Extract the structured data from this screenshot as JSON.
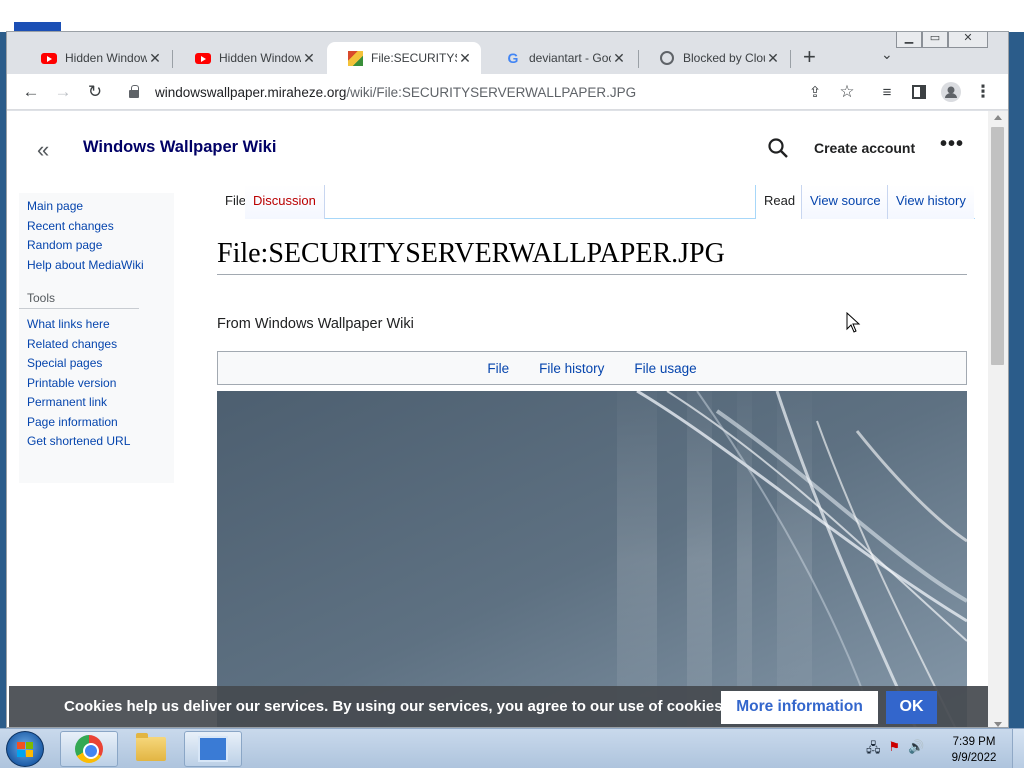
{
  "browser": {
    "tabs": [
      {
        "title": "Hidden Windows",
        "icon": "youtube-icon"
      },
      {
        "title": "Hidden Windows",
        "icon": "youtube-icon"
      },
      {
        "title": "File:SECURITYSERVERWALLPAPER",
        "icon": "wiki-favicon"
      },
      {
        "title": "deviantart - Google",
        "icon": "google-icon"
      },
      {
        "title": "Blocked by Cloudflare",
        "icon": "globe-icon"
      }
    ],
    "url_host": "windowswallpaper.miraheze.org",
    "url_path": "/wiki/File:SECURITYSERVERWALLPAPER.JPG"
  },
  "wiki": {
    "site_title": "Windows Wallpaper Wiki",
    "create_account": "Create account",
    "sidebar": {
      "nav": [
        "Main page",
        "Recent changes",
        "Random page",
        "Help about MediaWiki"
      ],
      "tools_heading": "Tools",
      "tools": [
        "What links here",
        "Related changes",
        "Special pages",
        "Printable version",
        "Permanent link",
        "Page information",
        "Get shortened URL"
      ]
    },
    "tabs": {
      "file": "File",
      "discussion": "Discussion",
      "read": "Read",
      "view_source": "View source",
      "view_history": "View history"
    },
    "page_title": "File:SECURITYSERVERWALLPAPER.JPG",
    "site_sub": "From Windows Wallpaper Wiki",
    "file_toc": [
      "File",
      "File history",
      "File usage"
    ]
  },
  "cookie": {
    "message": "Cookies help us deliver our services. By using our services, you agree to our use of cookies.",
    "more_info": "More information",
    "ok": "OK"
  },
  "taskbar": {
    "apps": [
      "chrome-icon",
      "file-explorer-icon",
      "control-panel-icon"
    ],
    "time": "7:39 PM",
    "date": "9/9/2022"
  },
  "colors": {
    "link": "#0645ad",
    "new_link": "#ba0000",
    "ok_button": "#3366cc",
    "site_title": "#000066"
  }
}
